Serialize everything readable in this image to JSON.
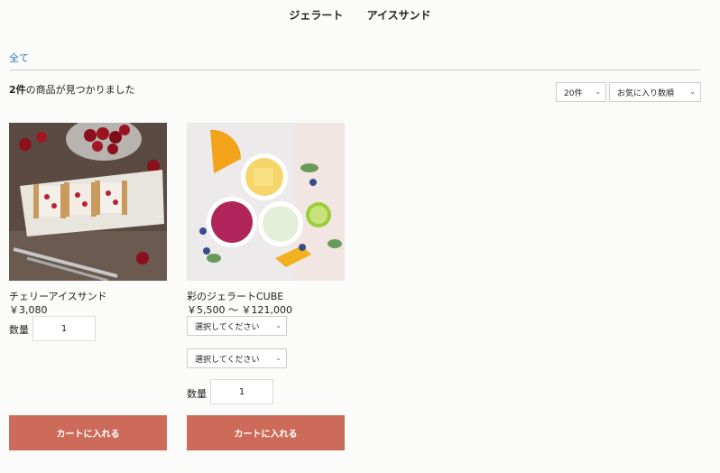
{
  "nav": {
    "gelato": "ジェラート",
    "ice_sand": "アイスサンド"
  },
  "breadcrumb": {
    "all": "全て"
  },
  "results": {
    "count": "2件",
    "suffix": "の商品が見つかりました"
  },
  "controls": {
    "per_page": "20件",
    "sort": "お気に入り数順"
  },
  "products": [
    {
      "name": "チェリーアイスサンド",
      "price": "￥3,080",
      "qty_label": "数量",
      "qty": "1",
      "cart": "カートに入れる"
    },
    {
      "name": "彩のジェラートCUBE",
      "price": "￥5,500 ～ ￥121,000",
      "option1": "選択してください",
      "option2": "選択してください",
      "qty_label": "数量",
      "qty": "1",
      "cart": "カートに入れる"
    }
  ]
}
